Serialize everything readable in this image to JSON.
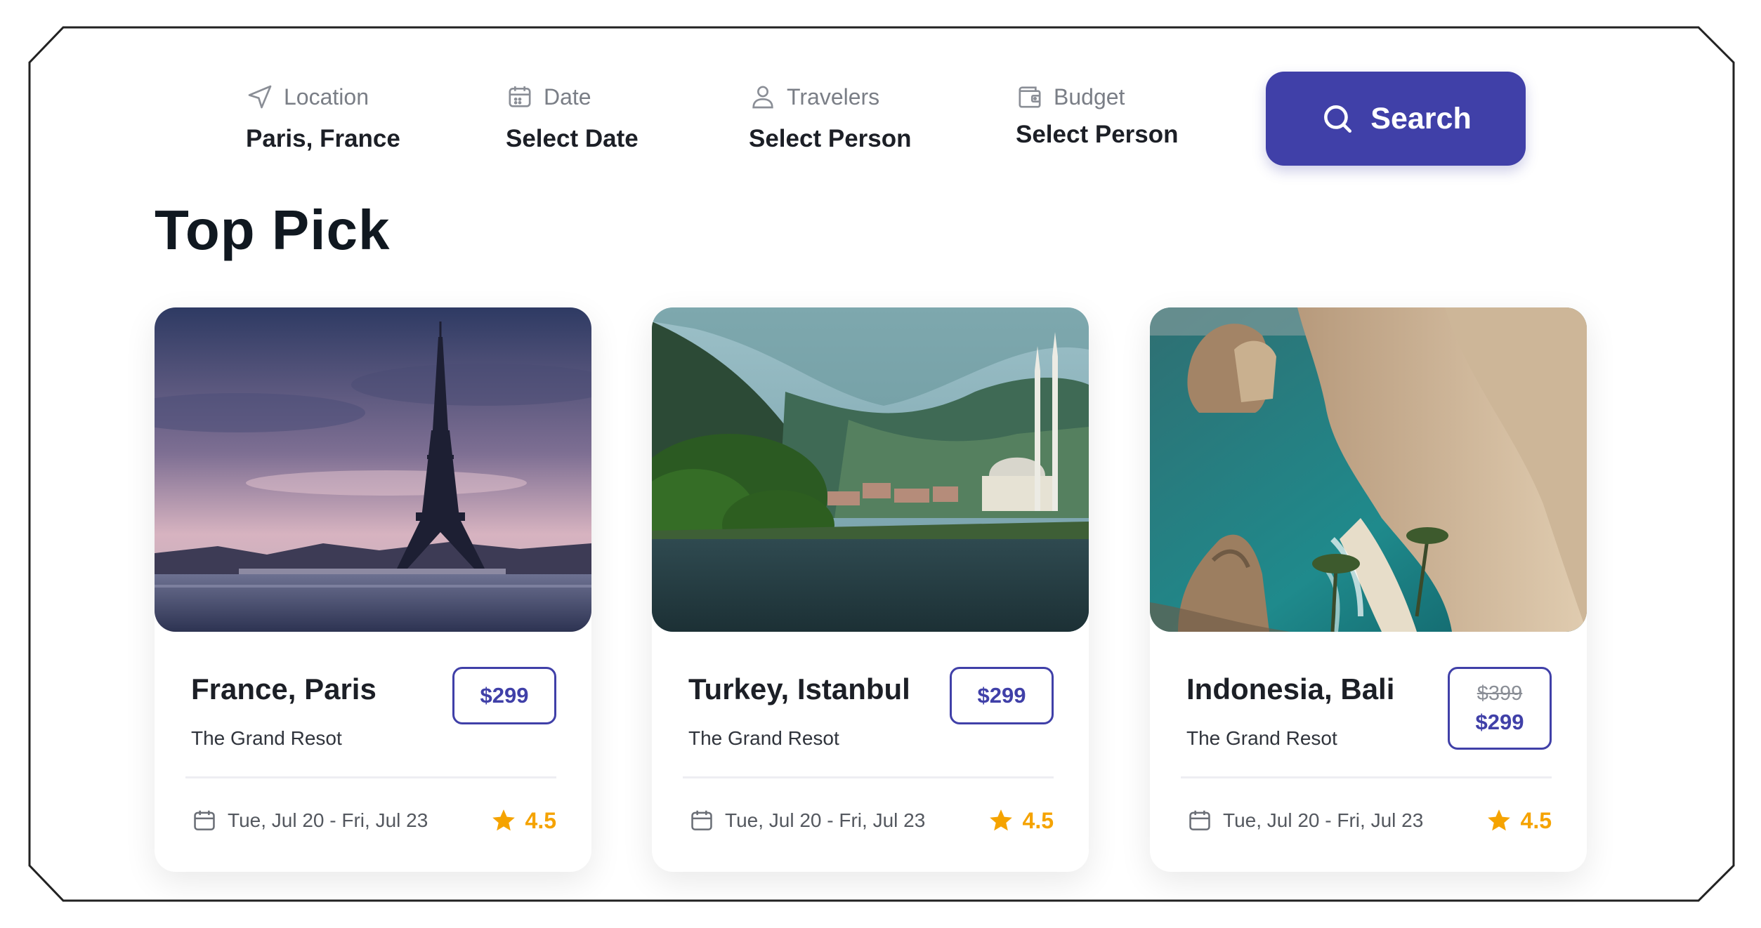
{
  "search": {
    "fields": [
      {
        "label": "Location",
        "value": "Paris, France"
      },
      {
        "label": "Date",
        "value": "Select Date"
      },
      {
        "label": "Travelers",
        "value": "Select Person"
      },
      {
        "label": "Budget",
        "value": "Select Person"
      }
    ],
    "button_label": "Search"
  },
  "section_title": "Top Pick",
  "cards": [
    {
      "title": "France, Paris",
      "subtitle": "The Grand Resot",
      "price": "$299",
      "dates": "Tue, Jul 20 - Fri, Jul 23",
      "rating": "4.5"
    },
    {
      "title": "Turkey, Istanbul",
      "subtitle": "The Grand Resot",
      "price": "$299",
      "dates": "Tue, Jul 20 - Fri, Jul 23",
      "rating": "4.5"
    },
    {
      "title": "Indonesia, Bali",
      "subtitle": "The Grand Resot",
      "old_price": "$399",
      "price": "$299",
      "dates": "Tue, Jul 20 - Fri, Jul 23",
      "rating": "4.5"
    }
  ],
  "colors": {
    "accent": "#4040a8",
    "star": "#f5a300",
    "heading": "#101820"
  }
}
